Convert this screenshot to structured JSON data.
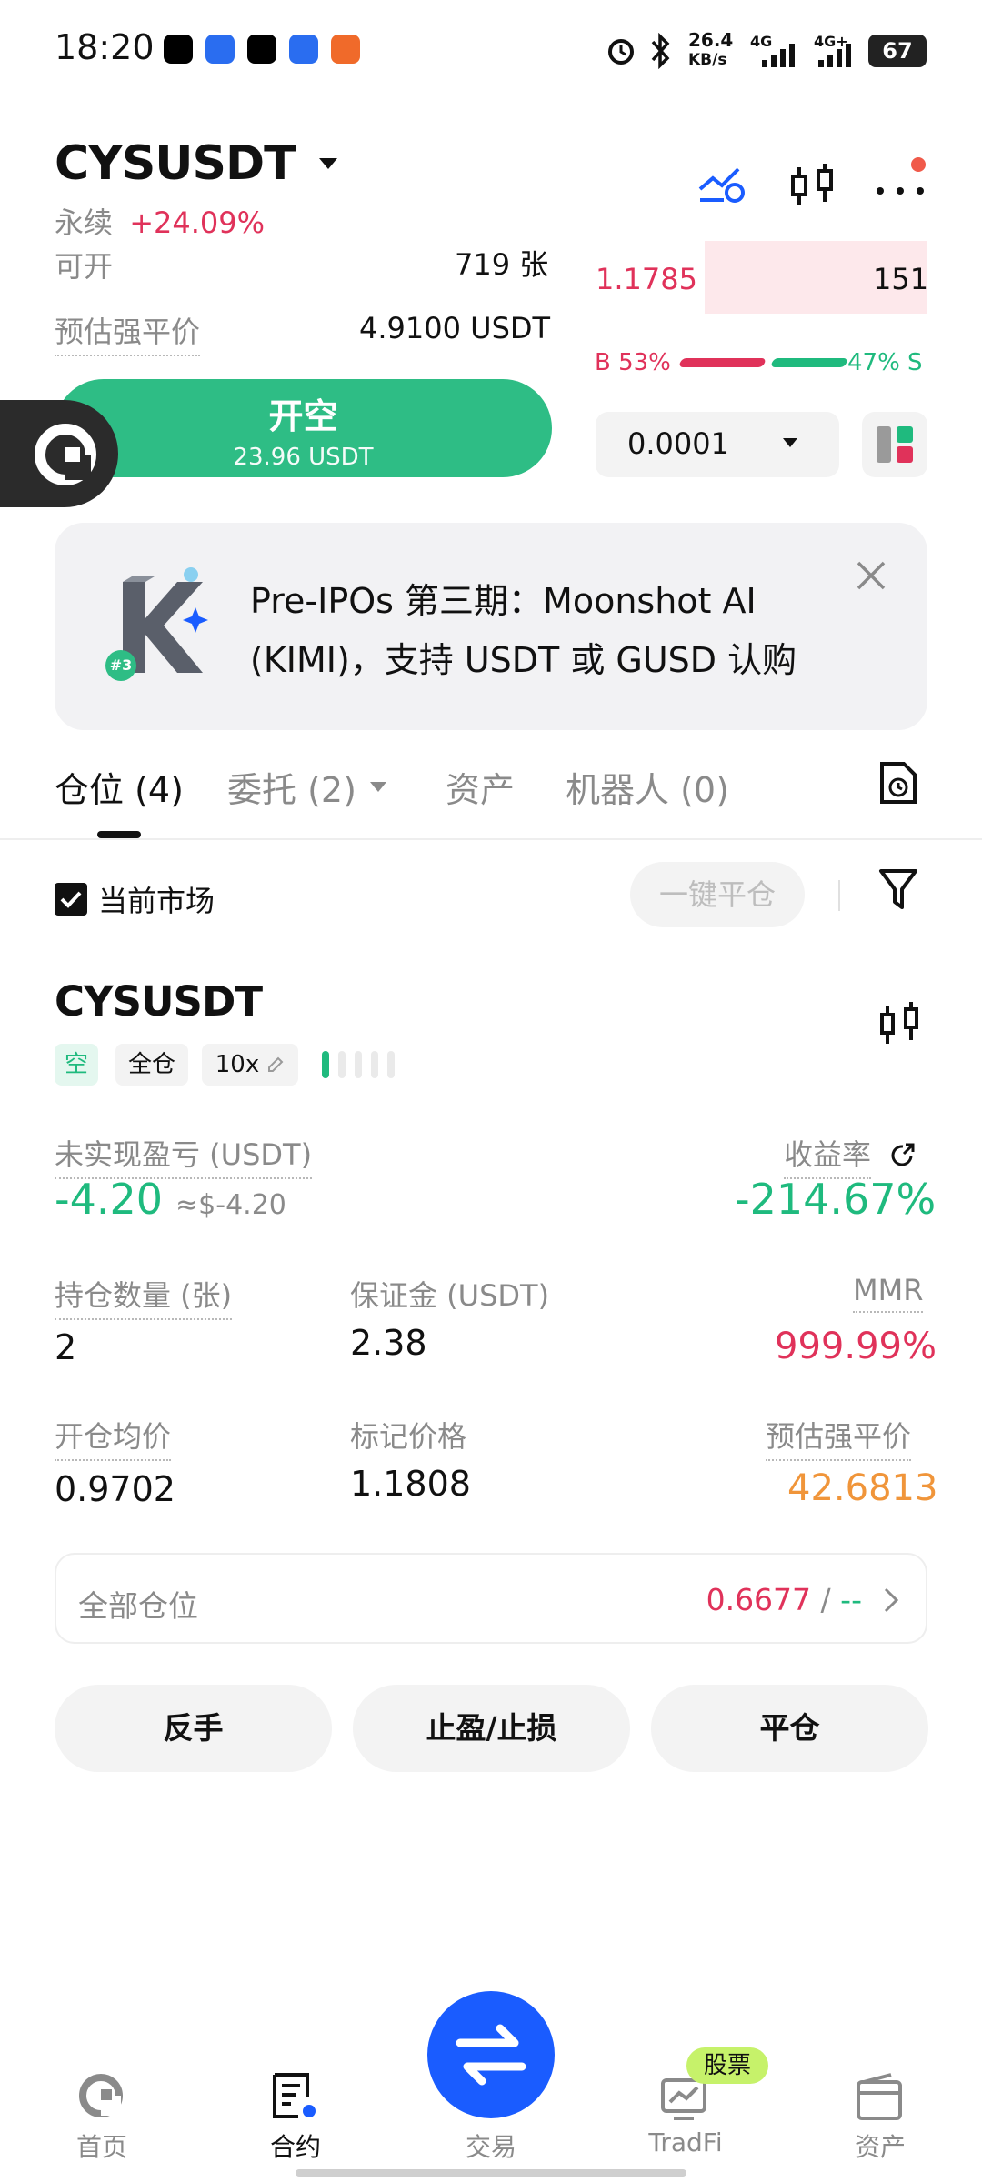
{
  "status_bar": {
    "time": "18:20",
    "net_speed_value": "26.4",
    "net_speed_unit": "KB/s",
    "sig1": "4G",
    "sig2": "4G+",
    "battery": "67"
  },
  "header": {
    "symbol": "CYSUSDT",
    "contract_type": "永续",
    "change_pct": "+24.09%"
  },
  "trade_panel": {
    "available_label": "可开",
    "available_value": "719 张",
    "liq_label": "预估强平价",
    "liq_value": "4.9100 USDT",
    "open_short_label": "开空",
    "open_short_amount": "23.96 USDT"
  },
  "order_book": {
    "ask_price": "1.1785",
    "ask_size": "151",
    "buy_ratio": "B 53%",
    "sell_ratio": "47% S",
    "buy_ratio_value": 53,
    "precision": "0.0001"
  },
  "banner": {
    "line1": "Pre-IPOs 第三期：Moonshot AI",
    "line2": "(KIMI)，支持 USDT 或 GUSD 认购",
    "badge": "#3"
  },
  "tabs": {
    "positions": "仓位 (4)",
    "orders": "委托 (2)",
    "assets": "资产",
    "bots": "机器人 (0)"
  },
  "filter": {
    "current_market": "当前市场",
    "close_all": "一键平仓"
  },
  "position": {
    "symbol": "CYSUSDT",
    "side": "空",
    "margin_mode": "全仓",
    "leverage": "10x",
    "upnl_label": "未实现盈亏 (USDT)",
    "upnl_value": "-4.20",
    "upnl_usd": "≈$-4.20",
    "roi_label": "收益率",
    "roi_value": "-214.67%",
    "size_label": "持仓数量 (张)",
    "size_value": "2",
    "margin_label": "保证金 (USDT)",
    "margin_value": "2.38",
    "mmr_label": "MMR",
    "mmr_value": "999.99%",
    "entry_label": "开仓均价",
    "entry_value": "0.9702",
    "mark_label": "标记价格",
    "mark_value": "1.1808",
    "liq_label": "预估强平价",
    "liq_value": "42.6813"
  },
  "all_positions": {
    "label": "全部仓位",
    "value": "0.6677",
    "separator": "/",
    "secondary": "--"
  },
  "actions": {
    "reverse": "反手",
    "tpsl": "止盈/止损",
    "close": "平仓"
  },
  "bottom_nav": {
    "home": "首页",
    "contract": "合约",
    "trade": "交易",
    "tradfi": "TradFi",
    "tradfi_badge": "股票",
    "assets": "资产"
  },
  "colors": {
    "green": "#2ebd85",
    "red": "#e0325a",
    "orange": "#f0953a",
    "blue": "#1a5cff"
  }
}
